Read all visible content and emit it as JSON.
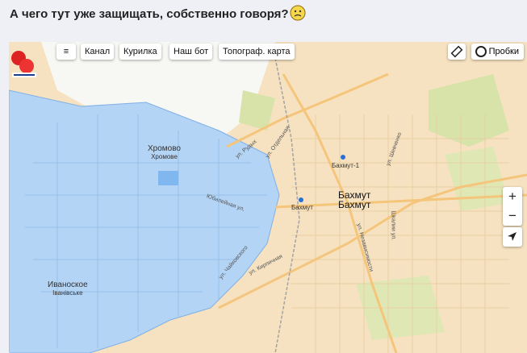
{
  "post": {
    "title": "А чего тут уже защищать, собственно говоря?"
  },
  "icons": {
    "emoji": "worried-face-icon",
    "menu": "menu-icon",
    "ruler": "ruler-icon",
    "traffic": "traffic-icon",
    "zoom_in": "plus-icon",
    "zoom_out": "minus-icon",
    "locate": "location-arrow-icon"
  },
  "toolbar": {
    "menu_label": "≡",
    "buttons": [
      "Канал",
      "Курилка",
      "Наш бот",
      "Топограф. карта"
    ],
    "traffic_label": "Пробки",
    "zoom_in": "+",
    "zoom_out": "−"
  },
  "map": {
    "places": [
      {
        "name": "Хромово",
        "alt": "Хромове"
      },
      {
        "name": "Иваноское",
        "alt": "Іванівське"
      },
      {
        "name": "Бахмут",
        "alt": "Бахмут"
      },
      {
        "name": "Бахмут-1"
      },
      {
        "name": "Бахмут"
      }
    ],
    "streets": [
      "ул. Рудых",
      "ул. Отдельная",
      "Юбилейная ул.",
      "ул. Чайковского",
      "ул. Кирпичная",
      "ул. Независимости",
      "ул. Шевченко",
      "Шкалии ул."
    ],
    "colors": {
      "land": "#f6e2c0",
      "occupied": "#b3d4f5",
      "road": "#f4c57a",
      "park": "#d7e3a8"
    }
  }
}
